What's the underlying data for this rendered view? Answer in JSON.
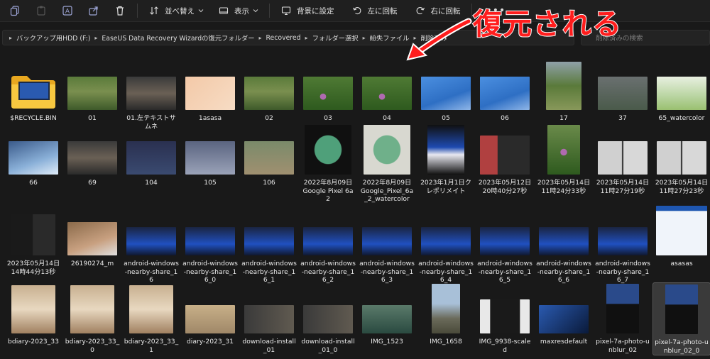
{
  "toolbar": {
    "sort_label": "並べ替え",
    "view_label": "表示",
    "set_background_label": "背景に設定",
    "rotate_left_label": "左に回転",
    "rotate_right_label": "右に回転",
    "more_label": "•••"
  },
  "address": {
    "breadcrumbs": [
      "バックアップ用HDD (F:)",
      "EaseUS Data Recovery Wizardの復元フォルダー",
      "Recovered",
      "フォルダー選択",
      "紛失ファイル",
      "削除済み"
    ]
  },
  "search": {
    "placeholder": "削除済みの検索"
  },
  "annotation": {
    "text": "復元される"
  },
  "files": [
    {
      "name": "$RECYCLE.BIN",
      "kind": "folder"
    },
    {
      "name": "01",
      "kind": "photo-bird"
    },
    {
      "name": "01.左テキストサムネ",
      "kind": "photo-text"
    },
    {
      "name": "1asasa",
      "kind": "photo-peach"
    },
    {
      "name": "02",
      "kind": "photo-bird"
    },
    {
      "name": "03",
      "kind": "photo-flower"
    },
    {
      "name": "04",
      "kind": "photo-flower"
    },
    {
      "name": "05",
      "kind": "photo-blue"
    },
    {
      "name": "06",
      "kind": "photo-blue"
    },
    {
      "name": "17",
      "kind": "photo-bird-tall"
    },
    {
      "name": "37",
      "kind": "photo-gray"
    },
    {
      "name": "65_watercolor",
      "kind": "photo-water"
    },
    {
      "name": "66",
      "kind": "photo-snow"
    },
    {
      "name": "69",
      "kind": "photo-text"
    },
    {
      "name": "104",
      "kind": "photo-dusk"
    },
    {
      "name": "105",
      "kind": "photo-dusk2"
    },
    {
      "name": "106",
      "kind": "photo-kid"
    },
    {
      "name": "2022年8月09日 Google Pixel 6a 2",
      "kind": "photo-phone"
    },
    {
      "name": "2022年8月09日 Google_Pixel_6a_2_watercolor",
      "kind": "photo-phone-wc"
    },
    {
      "name": "2023年1月1日クレポリメイト",
      "kind": "photo-bottle"
    },
    {
      "name": "2023年05月12日 20時40分27秒",
      "kind": "photo-screen"
    },
    {
      "name": "2023年05月14日 11時24分33秒",
      "kind": "photo-flower-tall"
    },
    {
      "name": "2023年05月14日 11時27分19秒",
      "kind": "photo-box"
    },
    {
      "name": "2023年05月14日 11時27分23秒",
      "kind": "photo-box"
    },
    {
      "name": "2023年05月14日 14時44分13秒",
      "kind": "photo-phone-ui"
    },
    {
      "name": "26190274_m",
      "kind": "photo-desk"
    },
    {
      "name": "android-windows-nearby-share_16",
      "kind": "photo-nearby"
    },
    {
      "name": "android-windows-nearby-share_16_0",
      "kind": "photo-nearby"
    },
    {
      "name": "android-windows-nearby-share_16_1",
      "kind": "photo-nearby"
    },
    {
      "name": "android-windows-nearby-share_16_2",
      "kind": "photo-nearby"
    },
    {
      "name": "android-windows-nearby-share_16_3",
      "kind": "photo-nearby"
    },
    {
      "name": "android-windows-nearby-share_16_4",
      "kind": "photo-nearby"
    },
    {
      "name": "android-windows-nearby-share_16_5",
      "kind": "photo-nearby"
    },
    {
      "name": "android-windows-nearby-share_16_6",
      "kind": "photo-nearby"
    },
    {
      "name": "android-windows-nearby-share_16_7",
      "kind": "photo-nearby"
    },
    {
      "name": "asasas",
      "kind": "photo-web"
    },
    {
      "name": "bdiary-2023_33",
      "kind": "photo-cameras"
    },
    {
      "name": "bdiary-2023_33_0",
      "kind": "photo-cameras"
    },
    {
      "name": "bdiary-2023_33_1",
      "kind": "photo-cameras"
    },
    {
      "name": "diary-2023_31",
      "kind": "photo-sand"
    },
    {
      "name": "download-install_01",
      "kind": "photo-dl"
    },
    {
      "name": "download-install_01_0",
      "kind": "photo-dl"
    },
    {
      "name": "IMG_1523",
      "kind": "photo-lake"
    },
    {
      "name": "IMG_1658",
      "kind": "photo-sky"
    },
    {
      "name": "IMG_9938-scaled",
      "kind": "photo-device"
    },
    {
      "name": "maxresdefault",
      "kind": "photo-yt"
    },
    {
      "name": "pixel-7a-photo-unblur_02",
      "kind": "photo-pixel"
    },
    {
      "name": "pixel-7a-photo-unblur_02_0",
      "kind": "photo-pixel"
    }
  ]
}
